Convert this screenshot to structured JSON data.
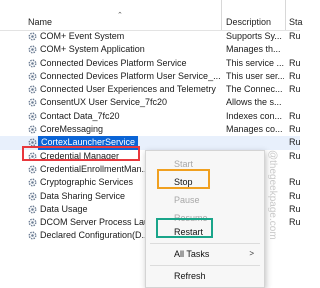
{
  "columns": {
    "name": "Name",
    "description": "Description",
    "status": "Sta"
  },
  "colors": {
    "selection": "#0a64d6",
    "highlight_red": "#e8383d",
    "highlight_orange": "#f0a020",
    "highlight_green": "#1aa58a"
  },
  "rows": [
    {
      "name": "COM+ Event System",
      "description": "Supports Sy...",
      "status": "Ru"
    },
    {
      "name": "COM+ System Application",
      "description": "Manages th...",
      "status": ""
    },
    {
      "name": "Connected Devices Platform Service",
      "description": "This service ...",
      "status": "Ru"
    },
    {
      "name": "Connected Devices Platform User Service_...",
      "description": "This user ser...",
      "status": "Ru"
    },
    {
      "name": "Connected User Experiences and Telemetry",
      "description": "The Connec...",
      "status": "Ru"
    },
    {
      "name": "ConsentUX User Service_7fc20",
      "description": "Allows the s...",
      "status": ""
    },
    {
      "name": "Contact Data_7fc20",
      "description": "Indexes con...",
      "status": "Ru"
    },
    {
      "name": "CoreMessaging",
      "description": "Manages co...",
      "status": "Ru"
    },
    {
      "name": "CortexLauncherService",
      "description": "",
      "status": "Ru"
    },
    {
      "name": "Credential Manager",
      "description": "",
      "status": "Ru"
    },
    {
      "name": "CredentialEnrollmentMan...",
      "description": "",
      "status": ""
    },
    {
      "name": "Cryptographic Services",
      "description": "",
      "status": "Ru"
    },
    {
      "name": "Data Sharing Service",
      "description": "",
      "status": "Ru"
    },
    {
      "name": "Data Usage",
      "description": "",
      "status": "Ru"
    },
    {
      "name": "DCOM Server Process Lau...",
      "description": "",
      "status": "Ru"
    },
    {
      "name": "Declared Configuration(D...",
      "description": "",
      "status": ""
    }
  ],
  "context_menu": {
    "start": "Start",
    "stop": "Stop",
    "pause": "Pause",
    "resume": "Resume",
    "restart": "Restart",
    "all_tasks": "All Tasks",
    "submenu_arrow": ">",
    "refresh": "Refresh"
  },
  "watermark": "@thegeekpage.com"
}
